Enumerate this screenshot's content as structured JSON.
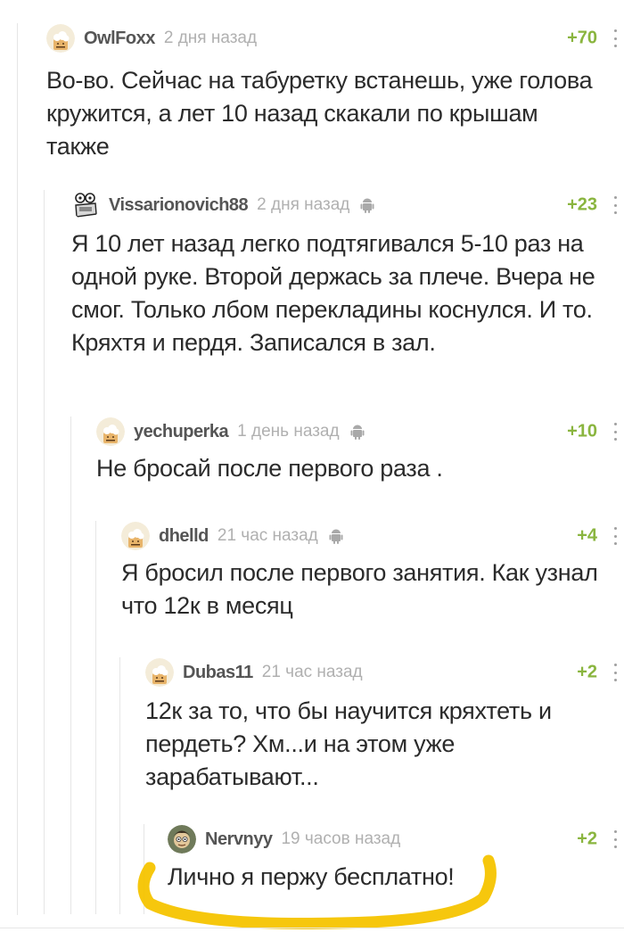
{
  "comments": [
    {
      "username": "OwlFoxx",
      "time": "2 дня назад",
      "rating": "+70",
      "avatar": "default-avatar",
      "android": false,
      "text": "Во-во. Сейчас на табуретку встанешь, уже голова кружится, а лет 10 назад скакали по крышам также"
    },
    {
      "username": "Vissarionovich88",
      "time": "2 дня назад",
      "rating": "+23",
      "avatar": "cartoon-avatar",
      "android": true,
      "text": "Я 10 лет назад легко подтягивался 5-10 раз на одной руке. Второй держась за плече. Вчера не смог. Только лбом перекладины коснулся. И то. Кряхтя и пердя. Записался в зал."
    },
    {
      "username": "yechuperka",
      "time": "1 день назад",
      "rating": "+10",
      "avatar": "default-avatar",
      "android": true,
      "text": "Не бросай после первого раза ."
    },
    {
      "username": "dhelld",
      "time": "21 час назад",
      "rating": "+4",
      "avatar": "default-avatar",
      "android": true,
      "text": "Я бросил после первого занятия. Как узнал что 12к в месяц"
    },
    {
      "username": "Dubas11",
      "time": "21 час назад",
      "rating": "+2",
      "avatar": "default-avatar",
      "android": false,
      "text": "12к за то, что бы научится кряхтеть и пердеть? Хм...и на этом уже зарабатывают..."
    },
    {
      "username": "Nervnyy",
      "time": "19 часов назад",
      "rating": "+2",
      "avatar": "photo-avatar",
      "android": false,
      "text": "Лично я пержу бесплатно!"
    }
  ],
  "colors": {
    "rating": "#8ab53f",
    "username": "#555555",
    "time": "#b0b0b0",
    "highlight": "#f5c400"
  }
}
